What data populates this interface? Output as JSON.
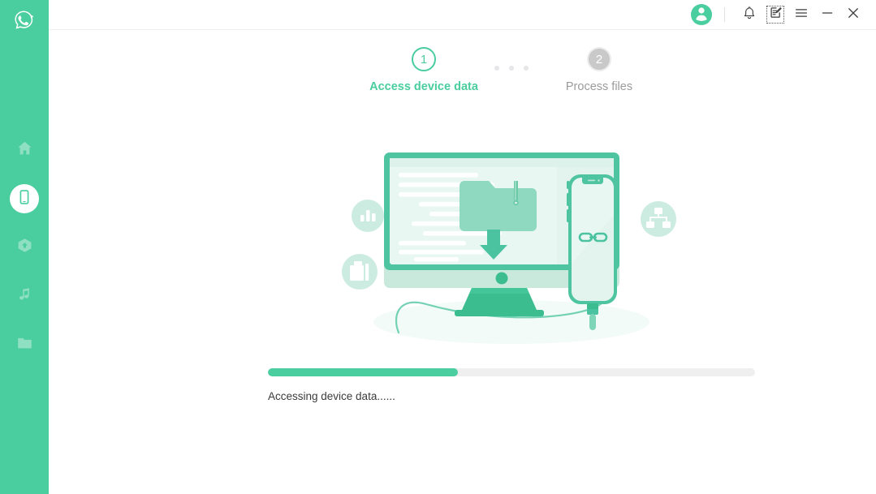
{
  "app": {
    "logo_icon": "whatsapp-transfer-logo-icon",
    "accent_color": "#4ACD9F",
    "sidebar_color": "#4ACD9F"
  },
  "sidebar": {
    "items": [
      {
        "name": "home",
        "icon": "home-icon",
        "active": false
      },
      {
        "name": "device",
        "icon": "phone-device-icon",
        "active": true
      },
      {
        "name": "backup",
        "icon": "cloud-backup-icon",
        "active": false
      },
      {
        "name": "media",
        "icon": "music-note-icon",
        "active": false
      },
      {
        "name": "files",
        "icon": "folder-icon",
        "active": false
      }
    ]
  },
  "titlebar": {
    "avatar_icon": "user-avatar-icon",
    "notification_icon": "bell-icon",
    "feedback_icon": "feedback-edit-icon",
    "menu_icon": "hamburger-menu-icon",
    "minimize_icon": "minimize-icon",
    "close_icon": "close-icon"
  },
  "steps": {
    "dots_count": 3,
    "items": [
      {
        "number": "1",
        "label": "Access device data",
        "state": "active"
      },
      {
        "number": "2",
        "label": "Process files",
        "state": "inactive"
      }
    ]
  },
  "illustration": {
    "name": "device-to-computer-transfer-illustration",
    "badges": [
      {
        "name": "bar-chart-badge-icon"
      },
      {
        "name": "archive-box-badge-icon"
      },
      {
        "name": "sitemap-hierarchy-badge-icon"
      }
    ],
    "monitor_icon": "desktop-monitor-icon",
    "folder_icon": "zipped-folder-icon",
    "download_icon": "download-arrow-icon",
    "phone_icon": "smartphone-icon",
    "link_icon": "chain-link-icon",
    "cable_icon": "usb-cable-icon"
  },
  "progress": {
    "percent": 39,
    "percent_label": "39%",
    "status": "Accessing device data......",
    "fill_color": "#4ACD9F",
    "track_color": "#EFEFEF"
  }
}
